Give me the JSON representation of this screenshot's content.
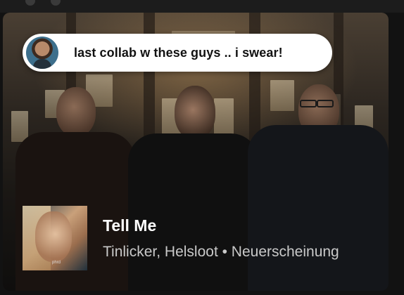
{
  "caption": {
    "text": "last collab w these guys .. i swear!"
  },
  "track": {
    "title": "Tell Me",
    "subtitle": "Tinlicker, Helsloot • Neuerscheinung"
  },
  "cover": {
    "label": "phrd"
  },
  "colors": {
    "background": "#121212",
    "bubble": "#ffffff",
    "title": "#ffffff",
    "subtitle": "#c9c9c9"
  }
}
